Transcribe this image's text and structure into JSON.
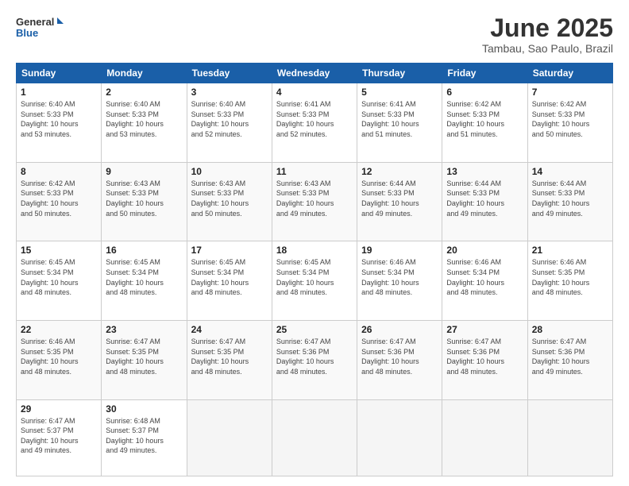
{
  "header": {
    "logo_line1": "General",
    "logo_line2": "Blue",
    "month_title": "June 2025",
    "location": "Tambau, Sao Paulo, Brazil"
  },
  "weekdays": [
    "Sunday",
    "Monday",
    "Tuesday",
    "Wednesday",
    "Thursday",
    "Friday",
    "Saturday"
  ],
  "weeks": [
    [
      {
        "day": "1",
        "info": "Sunrise: 6:40 AM\nSunset: 5:33 PM\nDaylight: 10 hours\nand 53 minutes."
      },
      {
        "day": "2",
        "info": "Sunrise: 6:40 AM\nSunset: 5:33 PM\nDaylight: 10 hours\nand 53 minutes."
      },
      {
        "day": "3",
        "info": "Sunrise: 6:40 AM\nSunset: 5:33 PM\nDaylight: 10 hours\nand 52 minutes."
      },
      {
        "day": "4",
        "info": "Sunrise: 6:41 AM\nSunset: 5:33 PM\nDaylight: 10 hours\nand 52 minutes."
      },
      {
        "day": "5",
        "info": "Sunrise: 6:41 AM\nSunset: 5:33 PM\nDaylight: 10 hours\nand 51 minutes."
      },
      {
        "day": "6",
        "info": "Sunrise: 6:42 AM\nSunset: 5:33 PM\nDaylight: 10 hours\nand 51 minutes."
      },
      {
        "day": "7",
        "info": "Sunrise: 6:42 AM\nSunset: 5:33 PM\nDaylight: 10 hours\nand 50 minutes."
      }
    ],
    [
      {
        "day": "8",
        "info": "Sunrise: 6:42 AM\nSunset: 5:33 PM\nDaylight: 10 hours\nand 50 minutes."
      },
      {
        "day": "9",
        "info": "Sunrise: 6:43 AM\nSunset: 5:33 PM\nDaylight: 10 hours\nand 50 minutes."
      },
      {
        "day": "10",
        "info": "Sunrise: 6:43 AM\nSunset: 5:33 PM\nDaylight: 10 hours\nand 50 minutes."
      },
      {
        "day": "11",
        "info": "Sunrise: 6:43 AM\nSunset: 5:33 PM\nDaylight: 10 hours\nand 49 minutes."
      },
      {
        "day": "12",
        "info": "Sunrise: 6:44 AM\nSunset: 5:33 PM\nDaylight: 10 hours\nand 49 minutes."
      },
      {
        "day": "13",
        "info": "Sunrise: 6:44 AM\nSunset: 5:33 PM\nDaylight: 10 hours\nand 49 minutes."
      },
      {
        "day": "14",
        "info": "Sunrise: 6:44 AM\nSunset: 5:33 PM\nDaylight: 10 hours\nand 49 minutes."
      }
    ],
    [
      {
        "day": "15",
        "info": "Sunrise: 6:45 AM\nSunset: 5:34 PM\nDaylight: 10 hours\nand 48 minutes."
      },
      {
        "day": "16",
        "info": "Sunrise: 6:45 AM\nSunset: 5:34 PM\nDaylight: 10 hours\nand 48 minutes."
      },
      {
        "day": "17",
        "info": "Sunrise: 6:45 AM\nSunset: 5:34 PM\nDaylight: 10 hours\nand 48 minutes."
      },
      {
        "day": "18",
        "info": "Sunrise: 6:45 AM\nSunset: 5:34 PM\nDaylight: 10 hours\nand 48 minutes."
      },
      {
        "day": "19",
        "info": "Sunrise: 6:46 AM\nSunset: 5:34 PM\nDaylight: 10 hours\nand 48 minutes."
      },
      {
        "day": "20",
        "info": "Sunrise: 6:46 AM\nSunset: 5:34 PM\nDaylight: 10 hours\nand 48 minutes."
      },
      {
        "day": "21",
        "info": "Sunrise: 6:46 AM\nSunset: 5:35 PM\nDaylight: 10 hours\nand 48 minutes."
      }
    ],
    [
      {
        "day": "22",
        "info": "Sunrise: 6:46 AM\nSunset: 5:35 PM\nDaylight: 10 hours\nand 48 minutes."
      },
      {
        "day": "23",
        "info": "Sunrise: 6:47 AM\nSunset: 5:35 PM\nDaylight: 10 hours\nand 48 minutes."
      },
      {
        "day": "24",
        "info": "Sunrise: 6:47 AM\nSunset: 5:35 PM\nDaylight: 10 hours\nand 48 minutes."
      },
      {
        "day": "25",
        "info": "Sunrise: 6:47 AM\nSunset: 5:36 PM\nDaylight: 10 hours\nand 48 minutes."
      },
      {
        "day": "26",
        "info": "Sunrise: 6:47 AM\nSunset: 5:36 PM\nDaylight: 10 hours\nand 48 minutes."
      },
      {
        "day": "27",
        "info": "Sunrise: 6:47 AM\nSunset: 5:36 PM\nDaylight: 10 hours\nand 48 minutes."
      },
      {
        "day": "28",
        "info": "Sunrise: 6:47 AM\nSunset: 5:36 PM\nDaylight: 10 hours\nand 49 minutes."
      }
    ],
    [
      {
        "day": "29",
        "info": "Sunrise: 6:47 AM\nSunset: 5:37 PM\nDaylight: 10 hours\nand 49 minutes."
      },
      {
        "day": "30",
        "info": "Sunrise: 6:48 AM\nSunset: 5:37 PM\nDaylight: 10 hours\nand 49 minutes."
      },
      {
        "day": "",
        "info": ""
      },
      {
        "day": "",
        "info": ""
      },
      {
        "day": "",
        "info": ""
      },
      {
        "day": "",
        "info": ""
      },
      {
        "day": "",
        "info": ""
      }
    ]
  ]
}
